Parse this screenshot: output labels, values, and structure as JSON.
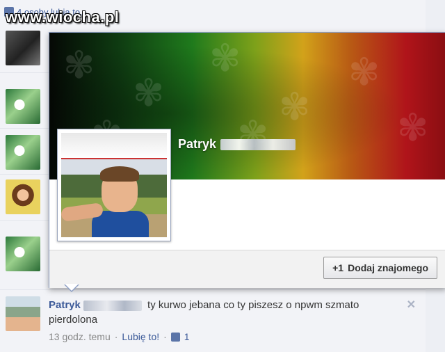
{
  "watermark": "www.wiocha.pl",
  "top_likes": {
    "text": "4 osoby lubią to."
  },
  "hovercard": {
    "name": "Patryk",
    "add_friend_icon": "+1",
    "add_friend_label": "Dodaj znajomego"
  },
  "comment": {
    "author": "Patryk",
    "text": "ty kurwo jebana co ty piszesz o npwm szmato pierdolona",
    "time": "13 godz. temu",
    "separator": "·",
    "like_label": "Lubię to!",
    "like_count": "1",
    "close": "✕"
  },
  "colors": {
    "link": "#3b5998",
    "hovercard_border": "#8b9dc3",
    "feed_bg": "#f2f3f7"
  }
}
